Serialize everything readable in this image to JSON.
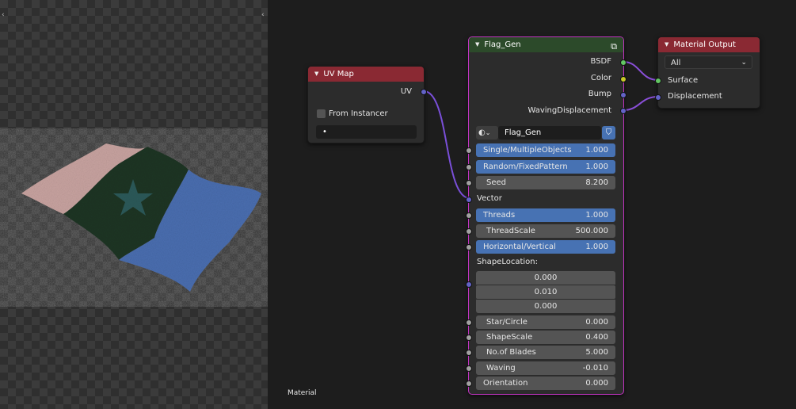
{
  "editor": {
    "footer_label": "Material"
  },
  "uv_map": {
    "title": "UV Map",
    "output_label": "UV",
    "checkbox_label": "From Instancer",
    "uv_value": "•"
  },
  "flag_gen": {
    "title": "Flag_Gen",
    "outputs": [
      "BSDF",
      "Color",
      "Bump",
      "WavingDisplacement"
    ],
    "group_name": "Flag_Gen",
    "inputs": [
      {
        "label": "Single/MultipleObjects",
        "value": "1.000"
      },
      {
        "label": "Random/FixedPattern",
        "value": "1.000"
      },
      {
        "label": "Seed",
        "value": "8.200"
      },
      {
        "label": "Vector",
        "value": ""
      },
      {
        "label": "Threads",
        "value": "1.000"
      },
      {
        "label": "ThreadScale",
        "value": "500.000"
      },
      {
        "label": "Horizontal/Vertical",
        "value": "1.000"
      },
      {
        "label": "ShapeLocation:",
        "value": ""
      }
    ],
    "shape_location": [
      "0.000",
      "0.010",
      "0.000"
    ],
    "inputs2": [
      {
        "label": "Star/Circle",
        "value": "0.000"
      },
      {
        "label": "ShapeScale",
        "value": "0.400"
      },
      {
        "label": "No.of Blades",
        "value": "5.000"
      },
      {
        "label": "Waving",
        "value": "-0.010"
      },
      {
        "label": "Orientation",
        "value": "0.000"
      }
    ]
  },
  "material_output": {
    "title": "Material Output",
    "target": "All",
    "inputs": [
      "Surface",
      "Displacement"
    ]
  },
  "colors": {
    "accent_blue": "#4772b3",
    "selected_outline": "#c233c2",
    "node_header_red": "#8a2933",
    "node_header_green": "#2c4a2a"
  }
}
